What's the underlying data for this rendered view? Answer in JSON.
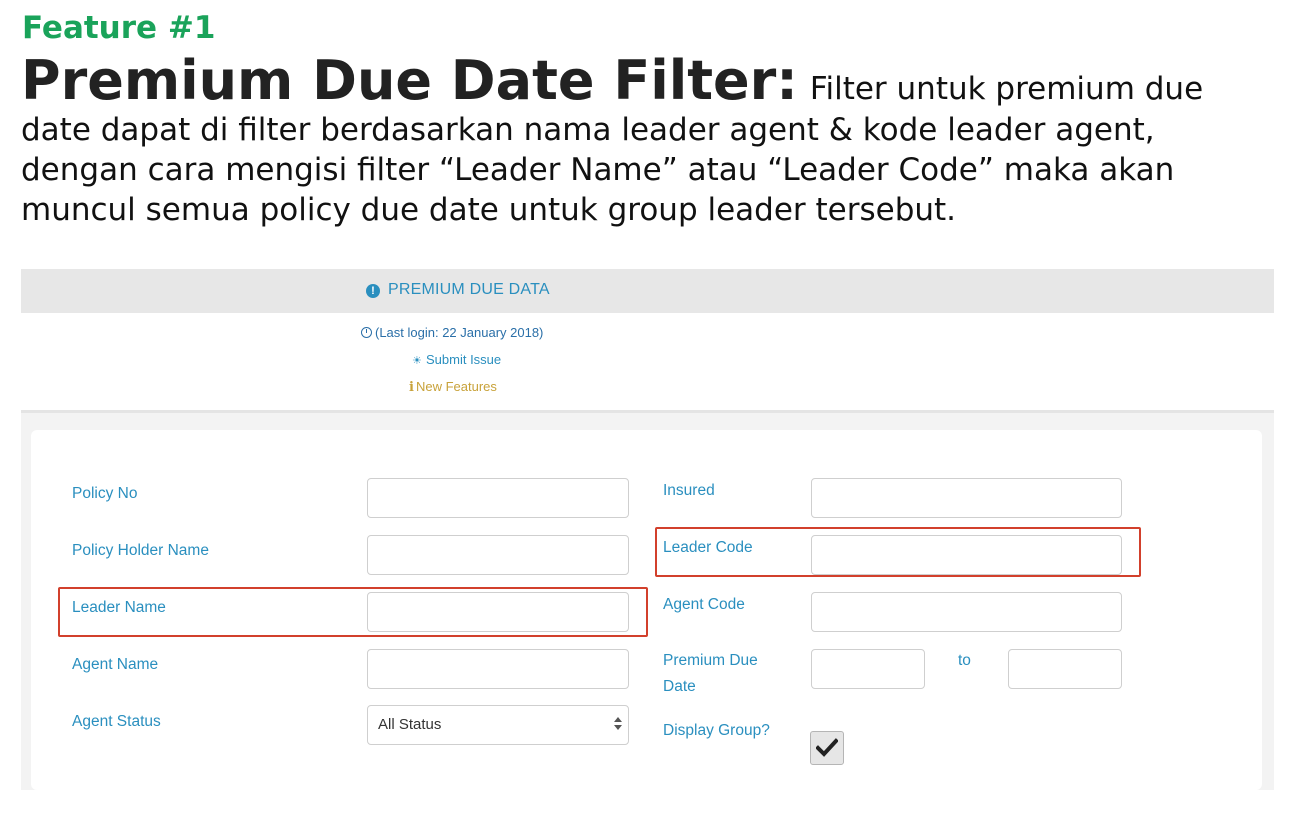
{
  "feature": {
    "label": "Feature #1",
    "title": "Premium Due Date Filter:",
    "description": "Filter untuk premium due date dapat di filter berdasarkan nama leader agent & kode leader agent, dengan cara mengisi filter “Leader Name” atau “Leader Code” maka akan muncul semua policy due date untuk group leader tersebut."
  },
  "header": {
    "icon": "info-circle-icon",
    "title": "PREMIUM DUE DATA",
    "last_login": "(Last login: 22 January 2018)",
    "submit_issue": "Submit Issue",
    "new_features": "New Features"
  },
  "form": {
    "policy_no": {
      "label": "Policy No",
      "value": ""
    },
    "policy_holder_name": {
      "label": "Policy Holder Name",
      "value": ""
    },
    "leader_name": {
      "label": "Leader Name",
      "value": ""
    },
    "agent_name": {
      "label": "Agent Name",
      "value": ""
    },
    "agent_status": {
      "label": "Agent Status",
      "selected": "All Status"
    },
    "insured": {
      "label": "Insured",
      "value": ""
    },
    "leader_code": {
      "label": "Leader Code",
      "value": ""
    },
    "agent_code": {
      "label": "Agent Code",
      "value": ""
    },
    "premium_due_date": {
      "label_line1": "Premium Due",
      "label_line2": "Date",
      "from": "",
      "to_label": "to",
      "to": ""
    },
    "display_group": {
      "label": "Display Group?",
      "checked": true
    }
  },
  "colors": {
    "accent": "#2a8fbf",
    "feature_green": "#1aa35a",
    "highlight_red": "#d2402c",
    "new_features_gold": "#c8a23a"
  }
}
